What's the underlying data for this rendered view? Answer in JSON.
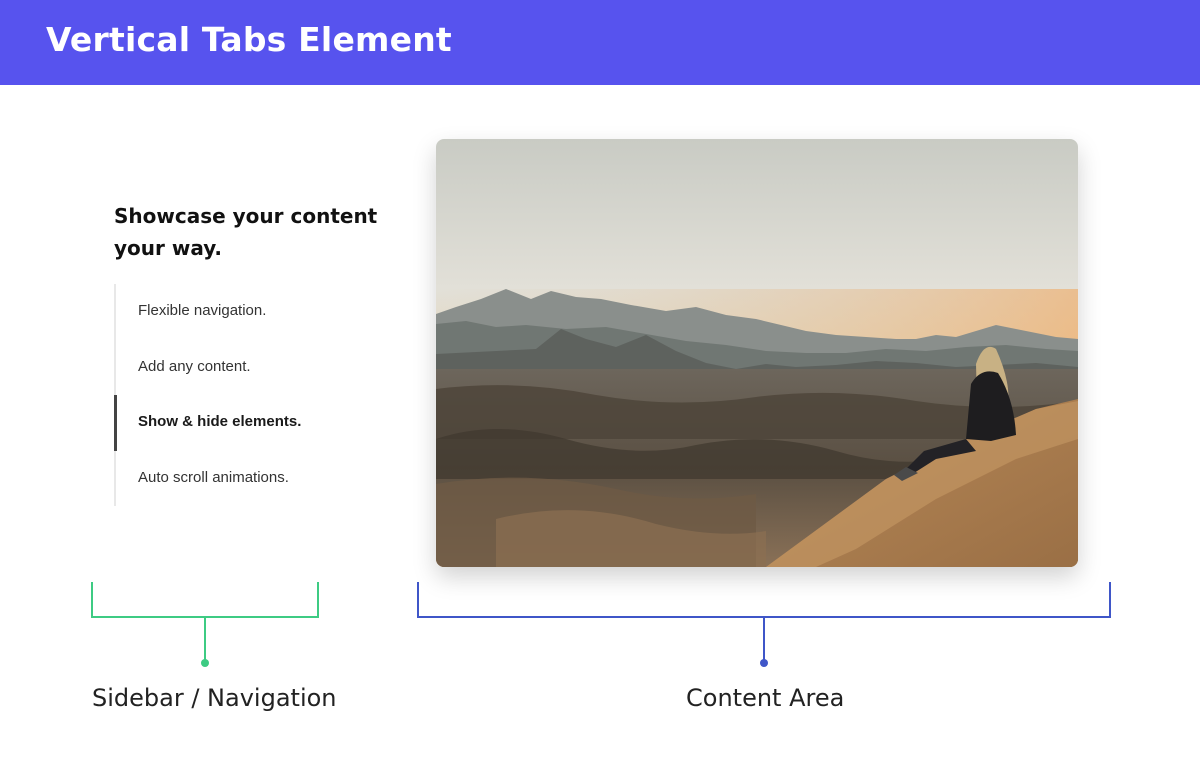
{
  "header": {
    "title": "Vertical Tabs Element"
  },
  "sidebar": {
    "heading": "Showcase your content your way.",
    "tabs": [
      {
        "label": "Flexible navigation.",
        "active": false
      },
      {
        "label": "Add any content.",
        "active": false
      },
      {
        "label": "Show & hide elements.",
        "active": true
      },
      {
        "label": "Auto scroll animations.",
        "active": false
      }
    ]
  },
  "content": {
    "image_icon": "desert-landscape-photo"
  },
  "annotations": {
    "sidebar_label": "Sidebar / Navigation",
    "content_label": "Content Area",
    "sidebar_color": "#3dcb83",
    "content_color": "#3f56c8"
  },
  "colors": {
    "header_bg": "#5753ee",
    "active_tab_border": "#444444"
  }
}
